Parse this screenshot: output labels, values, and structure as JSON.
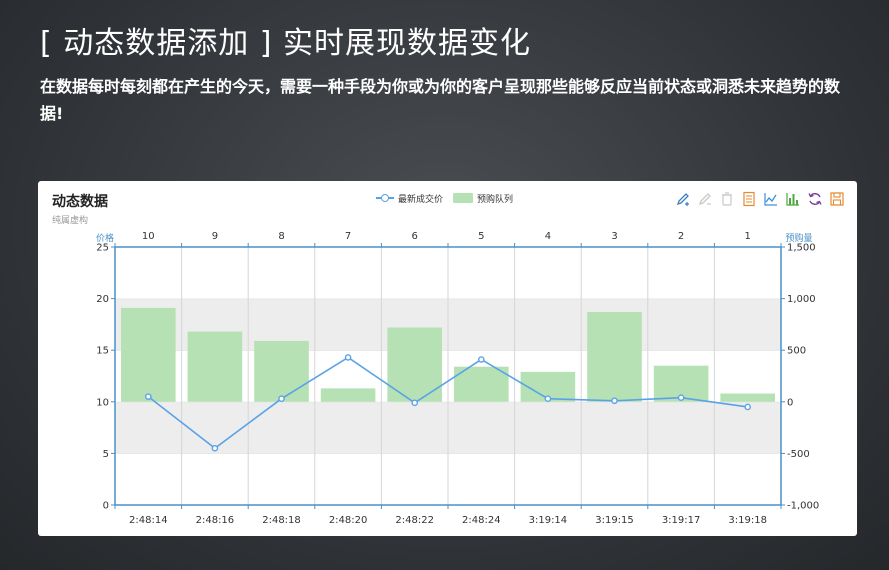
{
  "slide": {
    "title": "[ 动态数据添加 ] 实时展现数据变化",
    "description": "在数据每时每刻都在产生的今天，需要一种手段为你或为你的客户呈现那些能够反应当前状态或洞悉未来趋势的数据!"
  },
  "colors": {
    "background": "#3a3d41",
    "bar": "#b6e1b4",
    "line": "#5aa2e6",
    "axis": "#4a90c8",
    "band": "#ededed"
  },
  "toolbox": [
    {
      "name": "mark-icon",
      "color": "#3c7fc2"
    },
    {
      "name": "mark-undo-icon",
      "color": "#c8c8c8"
    },
    {
      "name": "mark-clear-icon",
      "color": "#c8c8c8"
    },
    {
      "name": "data-view-icon",
      "color": "#e38c2e"
    },
    {
      "name": "line-chart-icon",
      "color": "#3c8fd8"
    },
    {
      "name": "bar-chart-icon",
      "color": "#4caa3c"
    },
    {
      "name": "refresh-icon",
      "color": "#7c3a9c"
    },
    {
      "name": "save-image-icon",
      "color": "#e38c2e"
    }
  ],
  "chart_data": {
    "type": "bar",
    "title": "动态数据",
    "subtitle": "纯属虚构",
    "legend": [
      "最新成交价",
      "预购队列"
    ],
    "legend_position": "top-center",
    "grid": "horizontal bands",
    "x_bottom": {
      "categories": [
        "2:48:14",
        "2:48:16",
        "2:48:18",
        "2:48:20",
        "2:48:22",
        "2:48:24",
        "3:19:14",
        "3:19:15",
        "3:19:17",
        "3:19:18"
      ]
    },
    "x_top": {
      "label": "价格",
      "categories": [
        "10",
        "9",
        "8",
        "7",
        "6",
        "5",
        "4",
        "3",
        "2",
        "1"
      ]
    },
    "y_left": {
      "range": [
        0,
        25
      ],
      "ticks": [
        0,
        5,
        10,
        15,
        20,
        25
      ],
      "tick_labels": [
        "0",
        "5",
        "10",
        "15",
        "20",
        "25"
      ]
    },
    "y_right": {
      "label": "预购量",
      "range": [
        -1000,
        1500
      ],
      "ticks": [
        -1000,
        -500,
        0,
        500,
        1000,
        1500
      ],
      "tick_labels": [
        "-1,000",
        "-500",
        "0",
        "500",
        "1,000",
        "1,500"
      ]
    },
    "series": [
      {
        "name": "预购队列",
        "type": "bar",
        "axis": "left",
        "base": 10,
        "values": [
          19.1,
          16.8,
          15.9,
          11.3,
          17.2,
          13.4,
          12.9,
          18.7,
          13.5,
          10.8
        ]
      },
      {
        "name": "最新成交价",
        "type": "line",
        "axis": "right",
        "values": [
          50,
          -450,
          30,
          430,
          -10,
          410,
          30,
          10,
          40,
          -50
        ]
      }
    ]
  }
}
